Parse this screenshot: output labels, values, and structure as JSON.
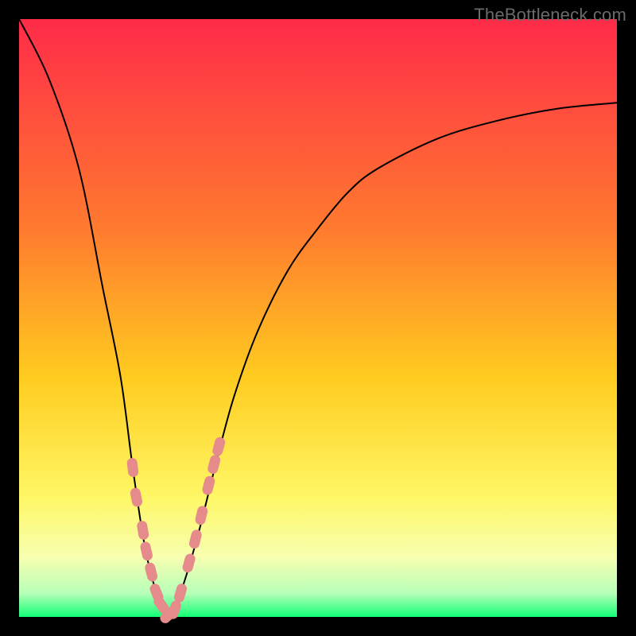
{
  "watermark": "TheBottleneck.com",
  "colors": {
    "gradient": {
      "top": "#ff2b49",
      "mid1": "#ff7a2f",
      "mid2": "#ffcc1f",
      "mid3": "#fff766",
      "low1": "#f7ffb0",
      "low2": "#b8ffb8",
      "bottom": "#12ff76"
    },
    "curve": "#000000",
    "markers": "#e58b8b"
  },
  "chart_data": {
    "type": "line",
    "title": "",
    "xlabel": "",
    "ylabel": "",
    "xlim": [
      0,
      100
    ],
    "ylim": [
      0,
      100
    ],
    "grid": false,
    "series": [
      {
        "name": "bottleneck-curve",
        "x": [
          0,
          5,
          10,
          14,
          17,
          19,
          21,
          23,
          25,
          27,
          30,
          33,
          36,
          40,
          45,
          50,
          55,
          60,
          70,
          80,
          90,
          100
        ],
        "values": [
          100,
          90,
          75,
          55,
          40,
          25,
          12,
          4,
          0,
          4,
          14,
          26,
          37,
          48,
          58,
          65,
          71,
          75,
          80,
          83,
          85,
          86
        ]
      }
    ],
    "annotations": {
      "minimum_x": 25,
      "minimum_y": 0
    },
    "markers": {
      "name": "highlight-near-minimum",
      "x": [
        19.0,
        19.6,
        20.7,
        21.3,
        22.1,
        23.0,
        23.8,
        25.0,
        26.0,
        27.0,
        28.4,
        29.5,
        30.5,
        31.7,
        32.6,
        33.4
      ],
      "y": [
        25.0,
        20.0,
        14.5,
        11.0,
        7.5,
        4.0,
        2.0,
        0.3,
        1.2,
        4.0,
        9.0,
        13.0,
        17.0,
        22.0,
        25.5,
        28.5
      ]
    }
  }
}
